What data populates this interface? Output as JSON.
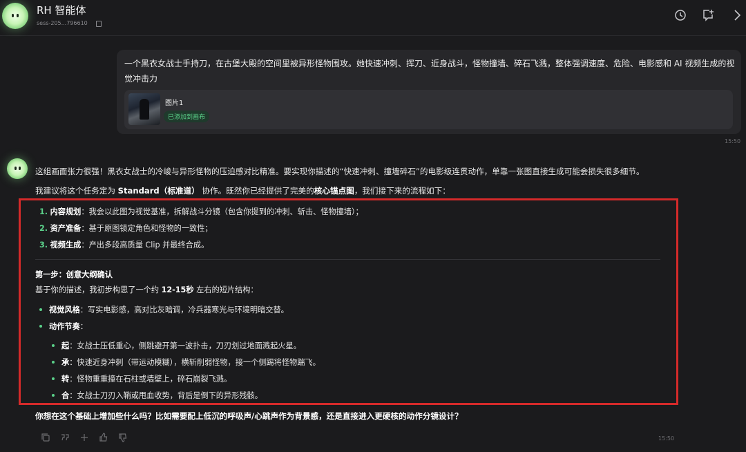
{
  "header": {
    "title": "RH 智能体",
    "session_id": "sess-205...796610"
  },
  "user_message": {
    "text": "一个黑衣女战士手持刀，在古堡大殿的空间里被异形怪物围攻。她快速冲刺、挥刀、近身战斗，怪物撞墙、碎石飞溅，整体强调速度、危险、电影感和 AI 视频生成的视觉冲击力",
    "attachment_name": "图片1",
    "attachment_status": "已添加到画布",
    "time": "15:50"
  },
  "ai_message": {
    "intro": {
      "text": "这组画面张力很强！黑衣女战士的冷峻与异形怪物的压迫感对比精准。要实现你描述的“快速冲刺、撞墙碎石”的电影级连贯动作，单靠一张图直接生成可能会损失很多细节。"
    },
    "plan": {
      "pre": "我建议将这个任务定为 ",
      "mode": "Standard（标准道）",
      "mid": " 协作。既然你已经提供了完美的",
      "anchor": "核心锚点图",
      "post": "，我们接下来的流程如下："
    },
    "steps": [
      {
        "num": "1.",
        "title": "内容规划",
        "text": "：我会以此图为视觉基准，拆解战斗分镜（包含你提到的冲刺、斩击、怪物撞墙）；"
      },
      {
        "num": "2.",
        "title": "资产准备",
        "text": "：基于原图锁定角色和怪物的一致性；"
      },
      {
        "num": "3.",
        "title": "视频生成",
        "text": "：产出多段高质量 Clip 并最终合成。"
      }
    ],
    "section_title": "第一步：创意大纲确认",
    "structure": {
      "pre": "基于你的描述，我初步构思了一个约 ",
      "duration": "12-15秒",
      "post": " 左右的短片结构："
    },
    "bullets": [
      {
        "title": "视觉风格",
        "text": "：写实电影感，高对比灰暗调，冷兵器寒光与环境明暗交替。"
      },
      {
        "title": "动作节奏",
        "text": "："
      }
    ],
    "beats": [
      {
        "title": "起",
        "text": "：女战士压低重心，侧跳避开第一波扑击，刀刃划过地面溅起火星。"
      },
      {
        "title": "承",
        "text": "：快速近身冲刺（带运动模糊），横斩削弱怪物，接一个侧踢将怪物踹飞。"
      },
      {
        "title": "转",
        "text": "：怪物重重撞在石柱或墙壁上，碎石崩裂飞溅。"
      },
      {
        "title": "合",
        "text": "：女战士刀刃入鞘或甩血收势，背后是倒下的异形残骸。"
      }
    ],
    "question": "你想在这个基础上增加些什么吗？比如需要配上低沉的呼吸声/心跳声作为背景感，还是直接进入更硬核的动作分镜设计？",
    "time": "15:50"
  },
  "icons": [
    "history-icon",
    "new-chat-icon",
    "chevron-right-icon",
    "copy-icon",
    "quote-icon",
    "add-icon",
    "thumbs-up-icon",
    "thumbs-down-icon"
  ],
  "colors": {
    "accent": "#5bd18a",
    "highlight_box": "#d42a2a",
    "background": "#1b1b1d"
  }
}
